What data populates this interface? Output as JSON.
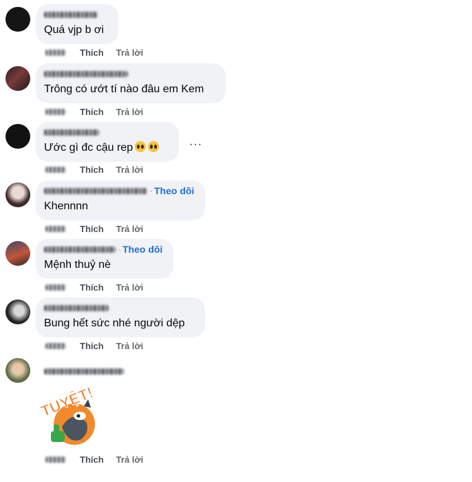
{
  "comments": [
    {
      "text": "Quá vjp b ơi",
      "follow": "",
      "like": "Thích",
      "reply": "Trả lời"
    },
    {
      "text": "Trông có ướt tí nào đâu em Kem",
      "follow": "",
      "like": "Thích",
      "reply": "Trả lời"
    },
    {
      "text": "Ước gì đc cậu rep",
      "emojis": [
        "crying-face-icon",
        "crying-face-icon"
      ],
      "follow": "",
      "like": "Thích",
      "reply": "Trả lời",
      "more": "…"
    },
    {
      "text": "Khennnn",
      "follow": "Theo dõi",
      "dot": "·",
      "like": "Thích",
      "reply": "Trả lời"
    },
    {
      "text": "Mệnh thuỷ nè",
      "follow": "Theo dõi",
      "dot": "·",
      "like": "Thích",
      "reply": "Trả lời"
    },
    {
      "text": "Bung hết sức nhé người dệp",
      "follow": "",
      "like": "Thích",
      "reply": "Trả lời"
    },
    {
      "sticker_text": "TUYỆT!",
      "like": "Thích",
      "reply": "Trả lời"
    }
  ]
}
